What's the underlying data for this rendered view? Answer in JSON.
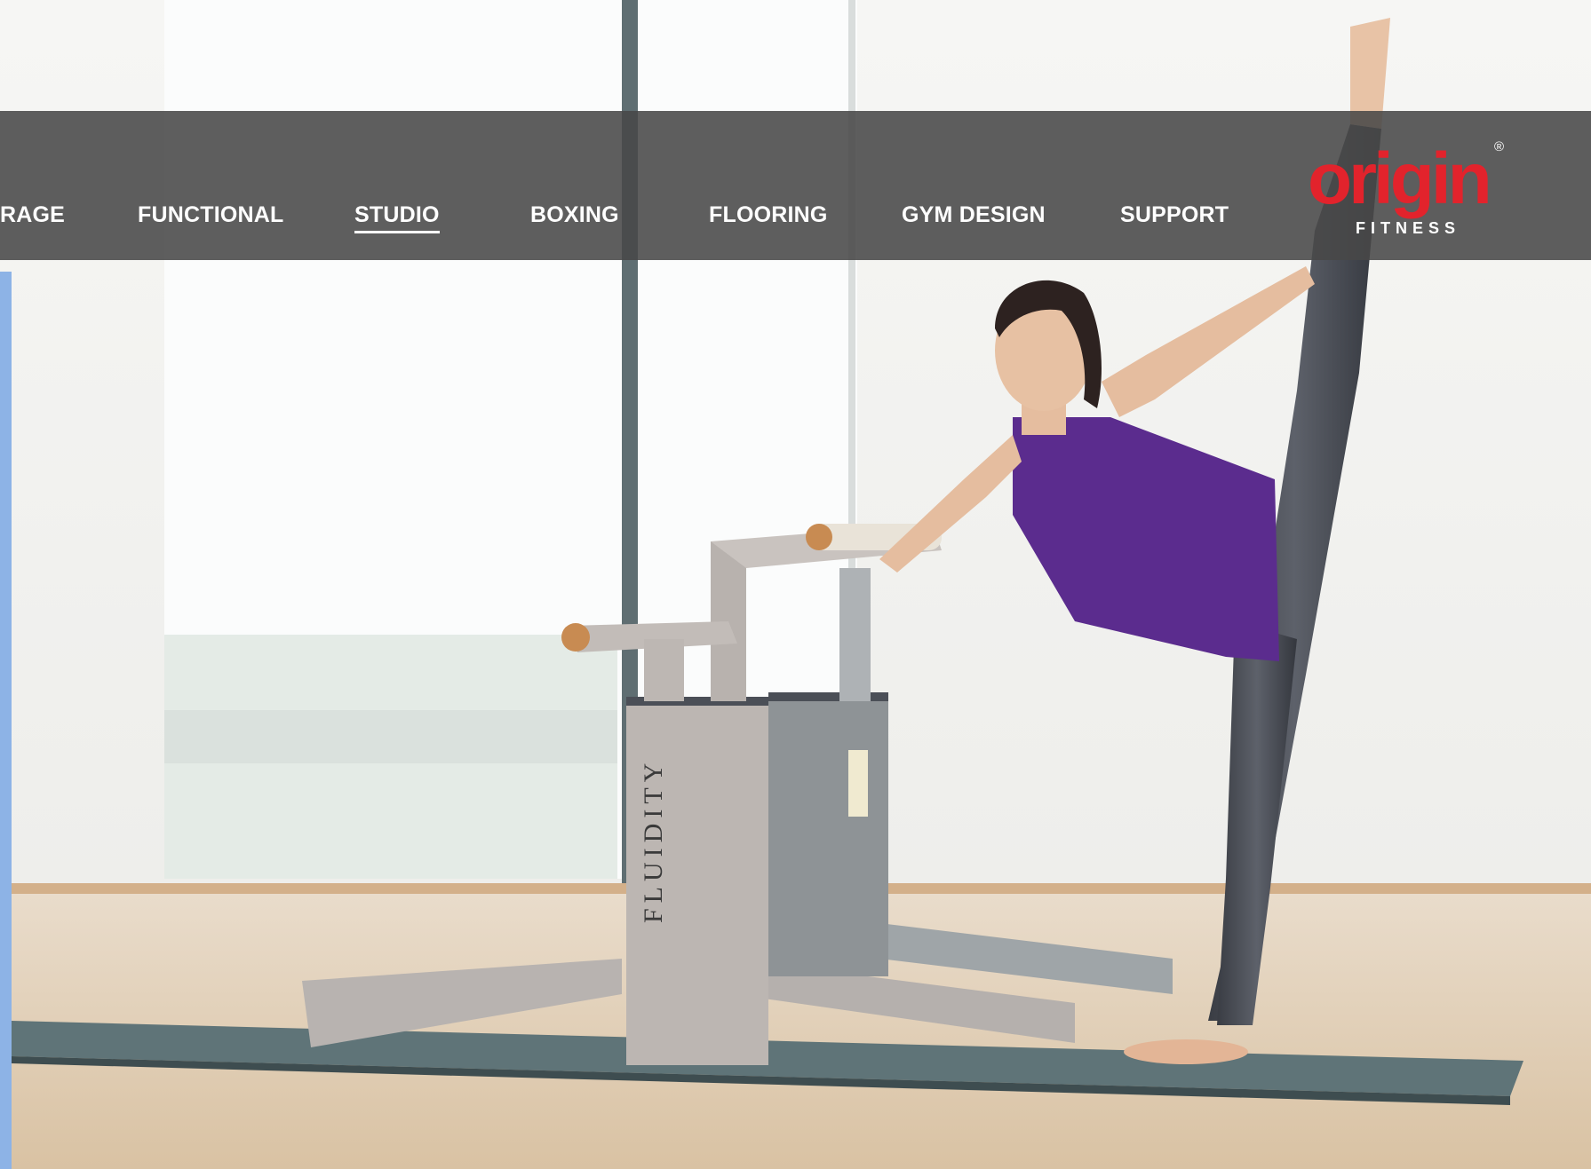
{
  "nav": {
    "items": [
      "RAGE",
      "FUNCTIONAL",
      "STUDIO",
      "BOXING",
      "FLOORING",
      "GYM DESIGN",
      "SUPPORT"
    ],
    "active": "STUDIO"
  },
  "logo": {
    "word": "origin",
    "sub": "FITNESS",
    "reg": "®"
  },
  "equipment": {
    "brand_text": "FLUIDITY"
  },
  "colors": {
    "brand_red": "#e2232c",
    "navbar": "#484848",
    "accent_blue": "#8db3e6",
    "top_purple": "#5b2c8e"
  }
}
